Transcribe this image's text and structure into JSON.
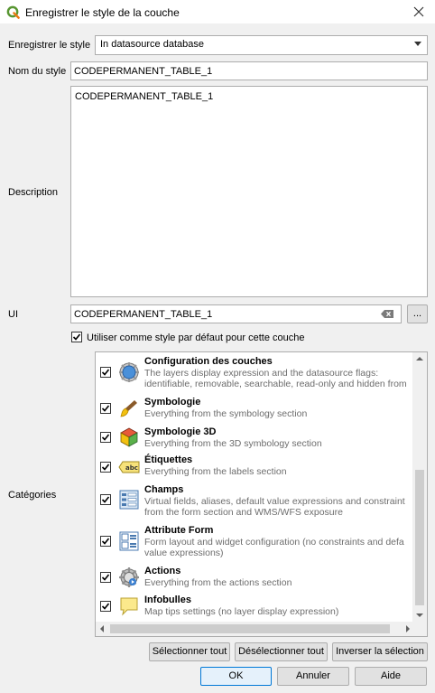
{
  "window": {
    "title": "Enregistrer le style de la couche"
  },
  "form": {
    "save_style_label": "Enregistrer le style",
    "save_style_value": "In datasource database",
    "style_name_label": "Nom du style",
    "style_name_value": "CODEPERMANENT_TABLE_1",
    "description_label": "Description",
    "description_value": "CODEPERMANENT_TABLE_1",
    "ui_label": "UI",
    "ui_value": "CODEPERMANENT_TABLE_1",
    "ui_browse": "...",
    "default_style_label": "Utiliser comme style par défaut pour cette couche",
    "default_style_checked": true,
    "categories_label": "Catégories"
  },
  "categories": [
    {
      "title": "Configuration des couches",
      "desc1": "The layers display expression and the datasource flags:",
      "desc2": "identifiable, removable, searchable, read-only and hidden from",
      "icon": "layer-config-icon",
      "checked": true
    },
    {
      "title": "Symbologie",
      "desc1": "Everything from the symbology section",
      "desc2": "",
      "icon": "paintbrush-icon",
      "checked": true
    },
    {
      "title": "Symbologie 3D",
      "desc1": "Everything from the 3D symbology section",
      "desc2": "",
      "icon": "cube-3d-icon",
      "checked": true
    },
    {
      "title": "Étiquettes",
      "desc1": "Everything from the labels section",
      "desc2": "",
      "icon": "label-abc-icon",
      "checked": true
    },
    {
      "title": "Champs",
      "desc1": "Virtual fields, aliases, default value expressions and constraint",
      "desc2": "from the form section and WMS/WFS exposure",
      "icon": "fields-icon",
      "checked": true
    },
    {
      "title": "Attribute Form",
      "desc1": "Form layout and widget configuration (no constraints and defa",
      "desc2": "value expressions)",
      "icon": "form-icon",
      "checked": true
    },
    {
      "title": "Actions",
      "desc1": "Everything from the actions section",
      "desc2": "",
      "icon": "actions-gear-icon",
      "checked": true
    },
    {
      "title": "Infobulles",
      "desc1": "Map tips settings (no layer display expression)",
      "desc2": "",
      "icon": "tooltip-icon",
      "checked": true
    }
  ],
  "buttons": {
    "select_all": "Sélectionner tout",
    "deselect_all": "Désélectionner tout",
    "invert": "Inverser la sélection",
    "ok": "OK",
    "cancel": "Annuler",
    "help": "Aide"
  },
  "colors": {
    "accent": "#0078d7",
    "qgis_green": "#589632"
  }
}
